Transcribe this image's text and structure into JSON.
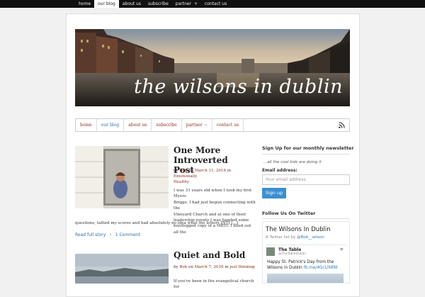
{
  "top_nav": {
    "items": [
      {
        "label": "home",
        "active": false
      },
      {
        "label": "our blog",
        "active": true
      },
      {
        "label": "about us",
        "active": false
      },
      {
        "label": "subscribe",
        "active": false
      },
      {
        "label": "partner",
        "active": false
      },
      {
        "label": "contact us",
        "active": false
      }
    ],
    "dropdown_glyph": "+"
  },
  "header": {
    "title": "the wilsons in dublin"
  },
  "main_nav": {
    "items": [
      {
        "label": "home",
        "active": false
      },
      {
        "label": "our blog",
        "active": true
      },
      {
        "label": "about us",
        "active": false
      },
      {
        "label": "subscribe",
        "active": false
      },
      {
        "label": "partner",
        "active": false
      },
      {
        "label": "contact us",
        "active": false
      }
    ],
    "dropdown_glyph": "→",
    "rss_icon": "rss-icon"
  },
  "posts": [
    {
      "title_line1": "One More Introverted",
      "title_line2": "Post",
      "meta_by": "by",
      "author": "Bob",
      "meta_on": "on",
      "date": "March 11, 2016",
      "meta_in": "in",
      "category_line1": "Emotionally",
      "category_line2": "Healthy",
      "excerpt_lines": [
        "I was 31 years old when I took my first Myers",
        "Briggs. I had just begun connecting with the",
        "Vineyard Church and at one of their",
        "leadership events I was handed some",
        "bootlegged copy of a MBTI. I filled out all the"
      ],
      "excerpt_tail": "questions, tallied my scores and had absolutely no idea what the letters INTJ […]",
      "read_more": "Read full story",
      "separator": "•",
      "comments": "1 Comment"
    },
    {
      "title": "Quiet and Bold",
      "meta_by": "by",
      "author": "Bob",
      "meta_on": "on",
      "date": "March 7, 2016",
      "meta_in": "in",
      "category": "just thinking",
      "excerpt_start": "If you've been in the evangelical church for"
    }
  ],
  "sidebar": {
    "newsletter": {
      "heading": "Sign Up for our monthly newsletter",
      "tagline": "...all the cool kids are doing it",
      "email_label": "Email address:",
      "email_placeholder": "Your email address",
      "button": "Sign up"
    },
    "twitter": {
      "heading": "Follow Us On Twitter",
      "widget_title": "The Wilsons In Dublin",
      "list_prefix": "A Twitter list by",
      "list_handle": "@Bob__wilson",
      "tweet": {
        "name": "The Table",
        "handle": "@TheTableDublin",
        "text_line1": "Happy St. Patrick's Day from the",
        "text_line2_start": "Wilsons in Dublin",
        "text_link": "fb.me/4GcUX8NI",
        "heart_icon": "heart-icon"
      }
    }
  },
  "colors": {
    "top_bar": "#111111",
    "link_red": "#8b2a1a",
    "link_blue": "#2b6fb0",
    "button_blue": "#3b8fd0"
  }
}
